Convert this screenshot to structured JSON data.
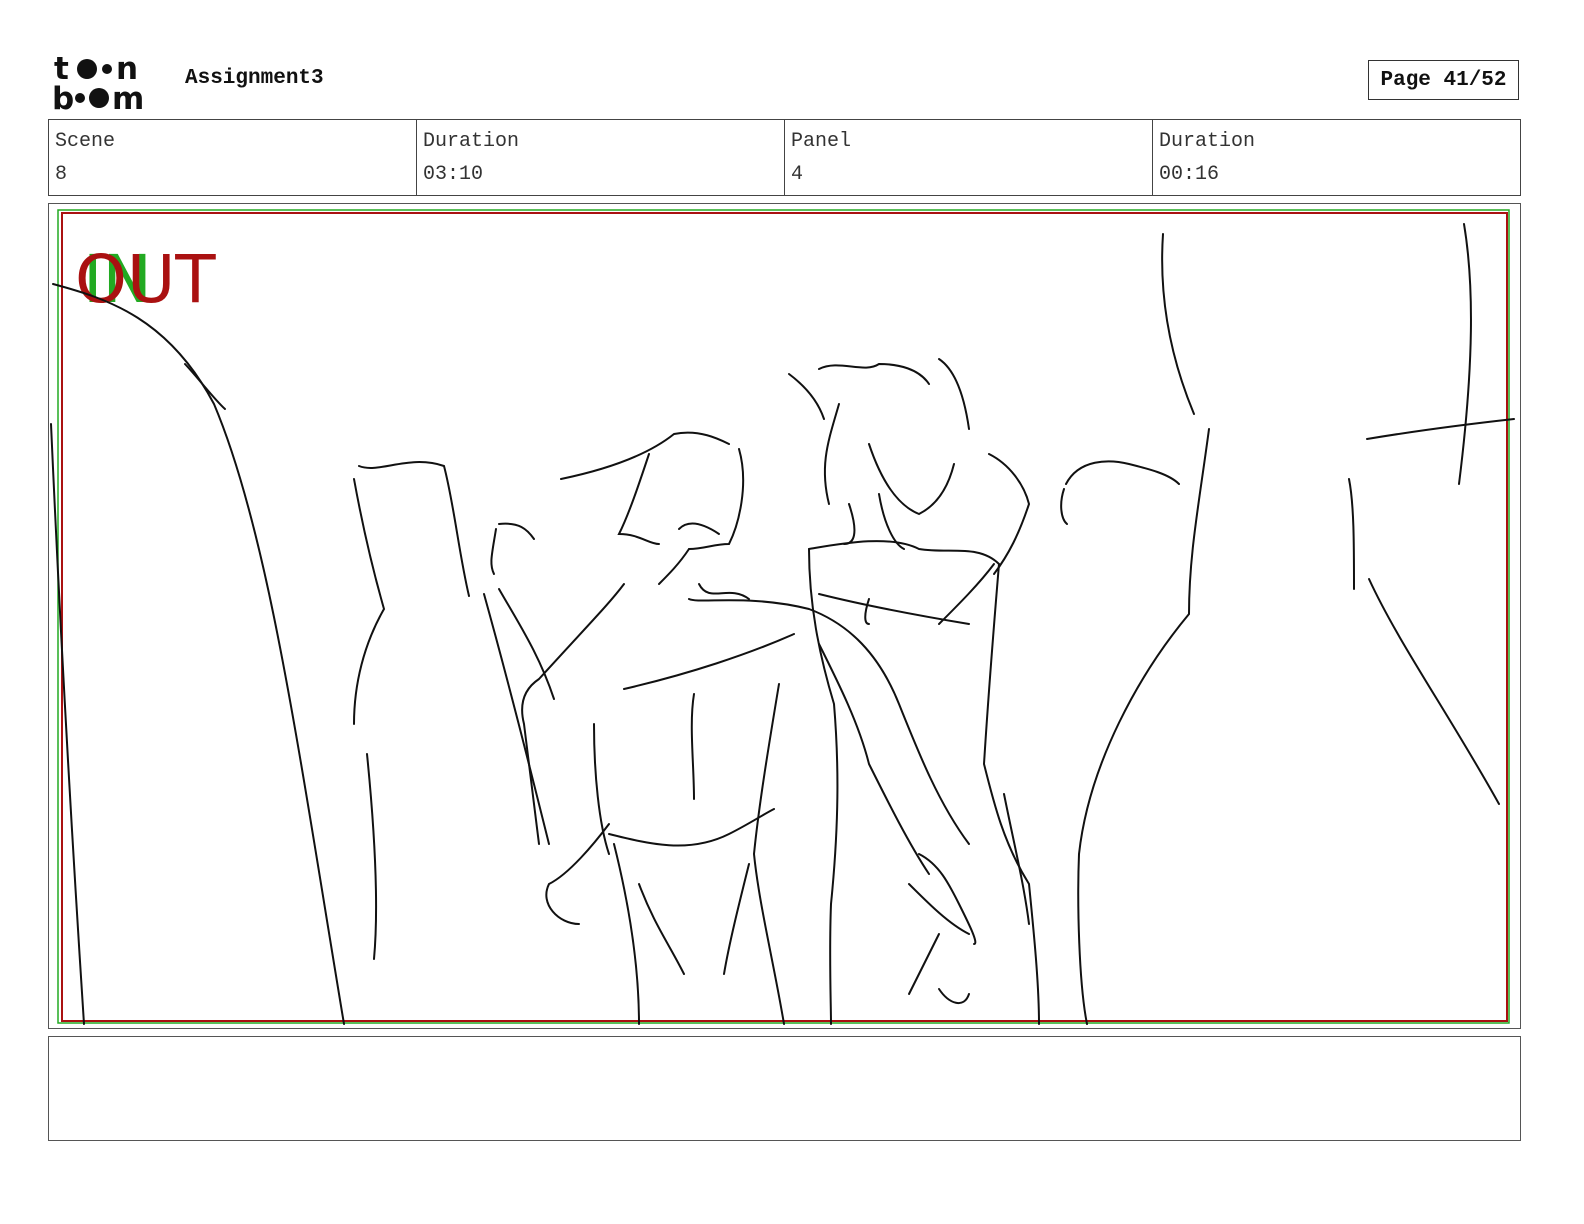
{
  "header": {
    "project_title": "Assignment3",
    "page_label": "Page 41/52",
    "logo_icon": "toonboom-logo"
  },
  "info": {
    "scene_label": "Scene",
    "scene_value": "8",
    "scene_duration_label": "Duration",
    "scene_duration_value": "03:10",
    "panel_label": "Panel",
    "panel_value": "4",
    "panel_duration_label": "Duration",
    "panel_duration_value": "00:16"
  },
  "panel": {
    "in_marker": "IN",
    "out_marker": "OUT",
    "in_color": "#22aa22",
    "out_color": "#aa1111"
  },
  "notes": {
    "text": ""
  }
}
